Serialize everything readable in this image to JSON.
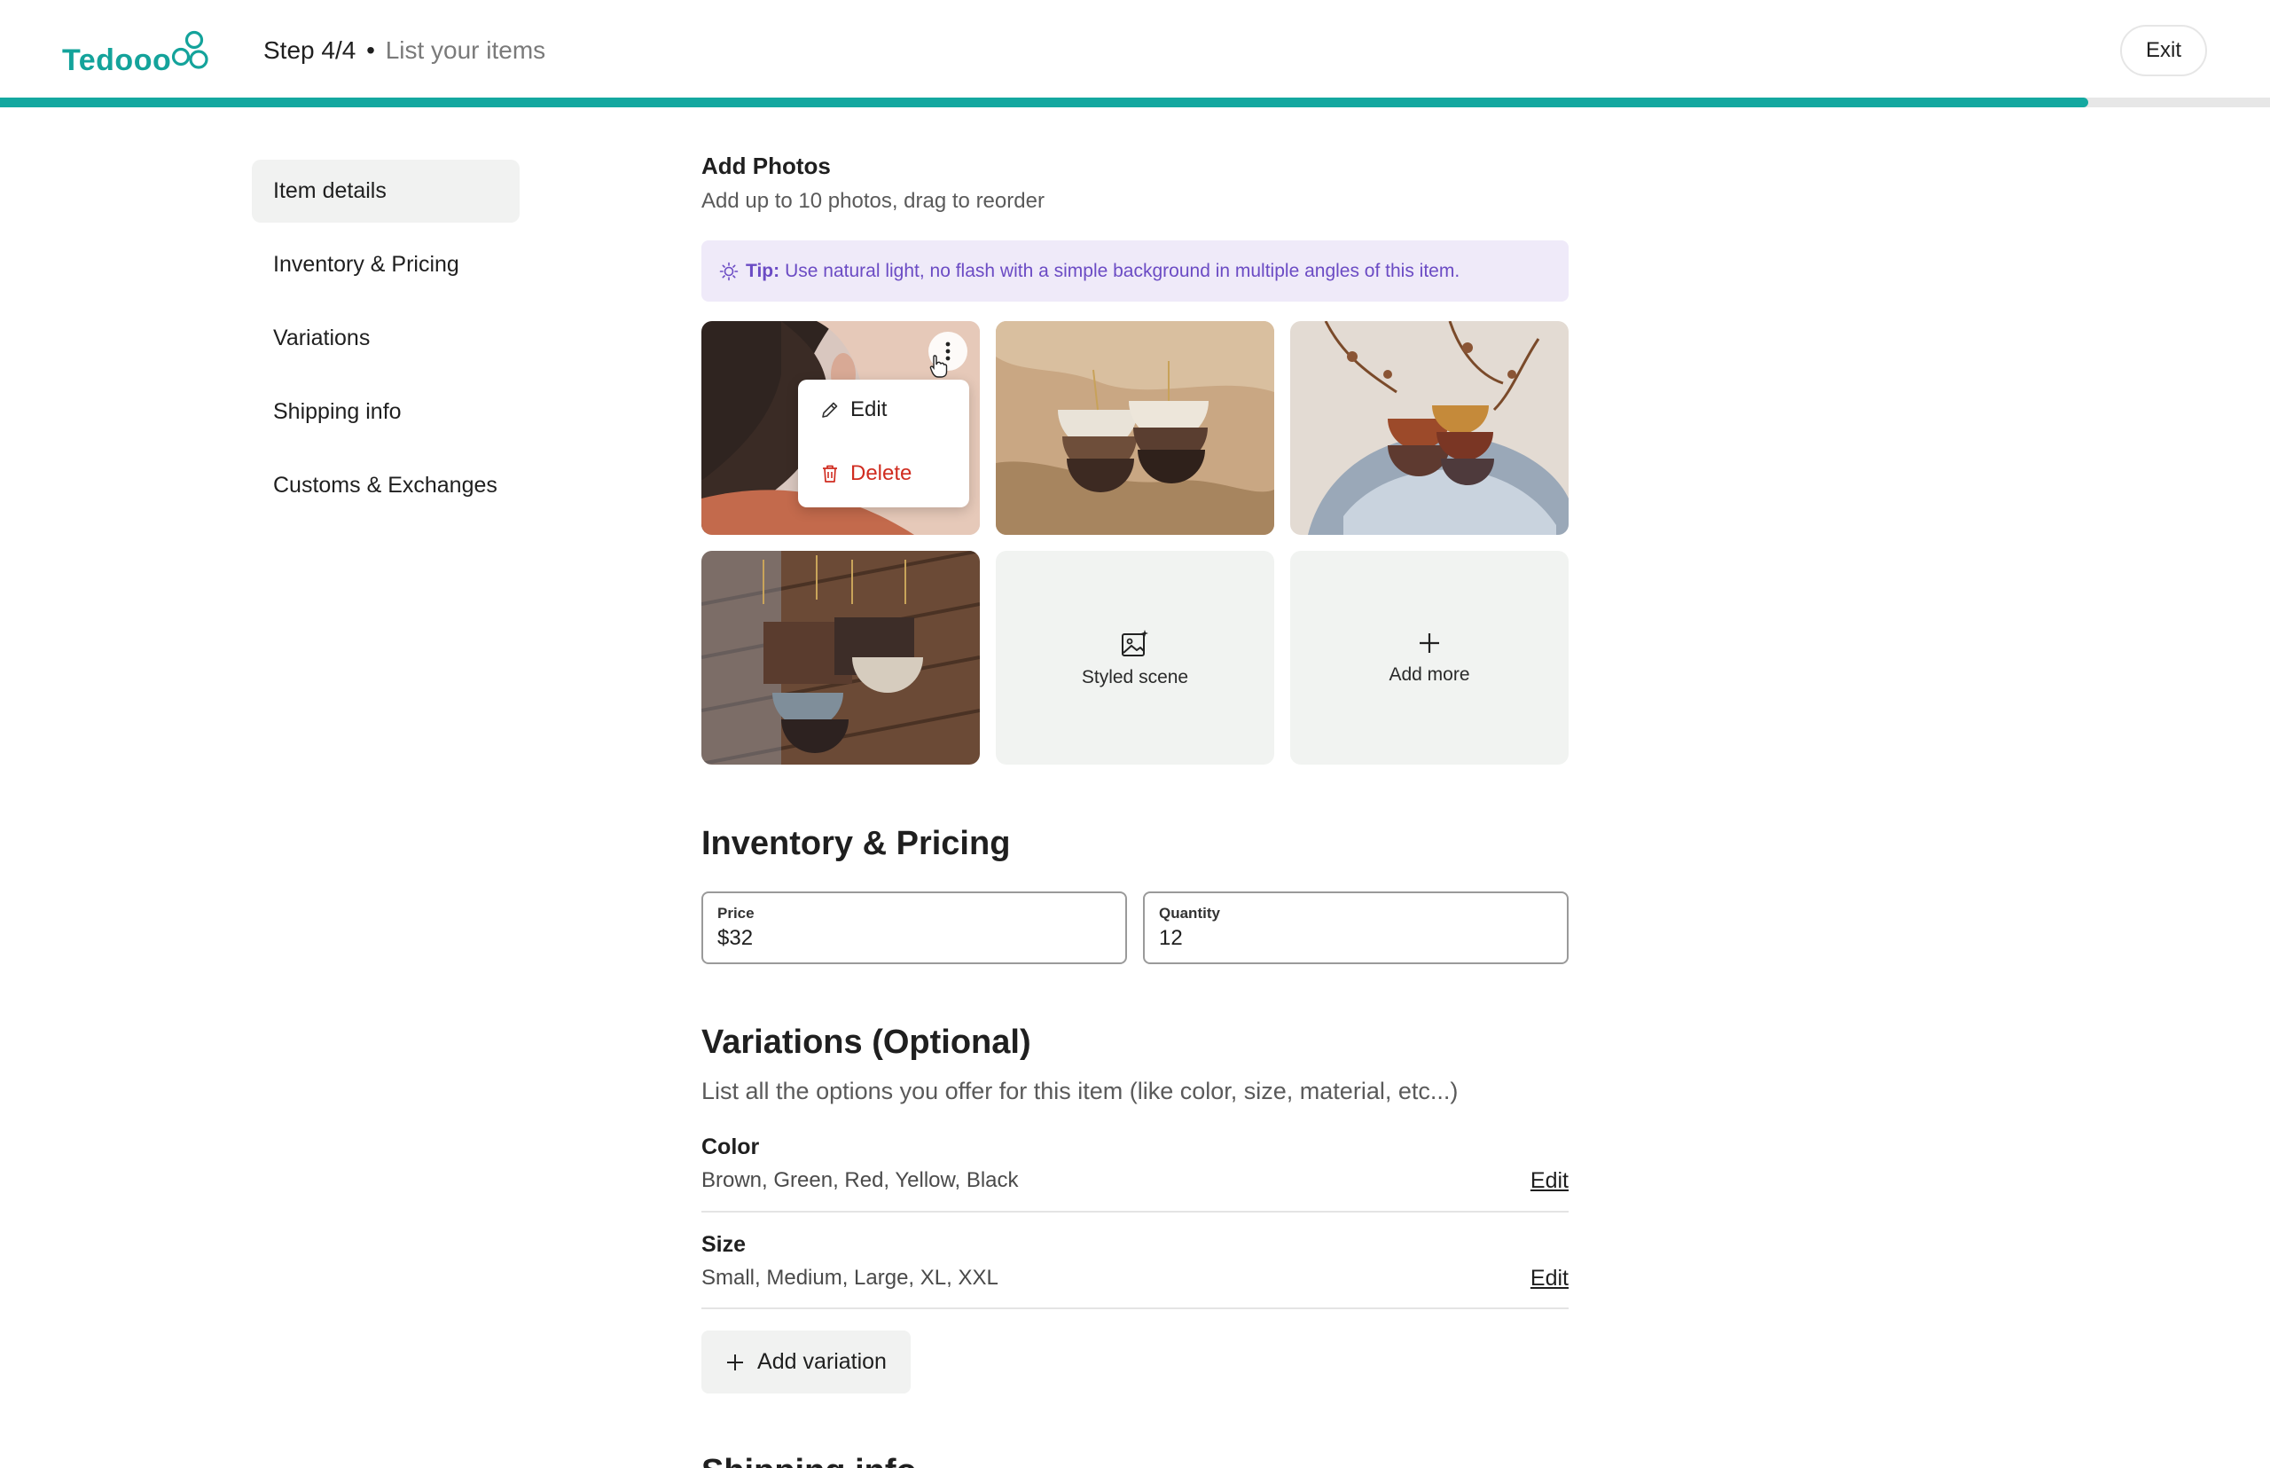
{
  "header": {
    "logo_text": "Tedooo",
    "step": "Step 4/4",
    "separator": "•",
    "step_subtitle": "List your items",
    "exit_label": "Exit",
    "progress_percent": 92,
    "accent_color": "#14a8a0"
  },
  "sidebar": {
    "items": [
      {
        "label": "Item details",
        "active": true
      },
      {
        "label": "Inventory & Pricing"
      },
      {
        "label": "Variations"
      },
      {
        "label": "Shipping info"
      },
      {
        "label": "Customs & Exchanges"
      }
    ]
  },
  "photos": {
    "title": "Add Photos",
    "subtitle": "Add up to 10 photos, drag to reorder",
    "tip_label": "Tip:",
    "tip_text": "Use natural light, no flash with a simple background in multiple angles of this item.",
    "menu": {
      "edit_label": "Edit",
      "delete_label": "Delete"
    },
    "styled_scene_label": "Styled scene",
    "add_more_label": "Add more"
  },
  "inventory": {
    "title": "Inventory & Pricing",
    "price_label": "Price",
    "price_value": "$32",
    "quantity_label": "Quantity",
    "quantity_value": "12"
  },
  "variations": {
    "title": "Variations (Optional)",
    "subtitle": "List all the options you offer for this item (like color, size, material, etc...)",
    "items": [
      {
        "name": "Color",
        "values": "Brown, Green, Red, Yellow, Black",
        "edit_label": "Edit"
      },
      {
        "name": "Size",
        "values": "Small, Medium, Large, XL, XXL",
        "edit_label": "Edit"
      }
    ],
    "add_label": "Add variation"
  },
  "next_section": {
    "title": "Shipping info"
  }
}
